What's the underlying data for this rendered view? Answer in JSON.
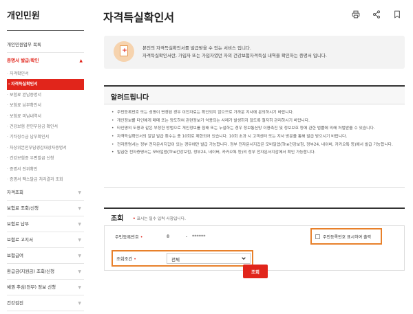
{
  "sidebar": {
    "title": "개인민원",
    "items": [
      {
        "label": "개인민원업무 목록",
        "kind": "top",
        "border": true
      },
      {
        "label": "증명서 발급/확인",
        "kind": "top",
        "active": true,
        "arrow": "▲"
      },
      {
        "label": "자격확인서",
        "kind": "sub"
      },
      {
        "label": "자격득실확인서",
        "kind": "sub",
        "current": true
      },
      {
        "label": "보험료 완납증명서",
        "kind": "sub"
      },
      {
        "label": "보험료 납부확인서",
        "kind": "sub"
      },
      {
        "label": "보험료 미납내역서",
        "kind": "sub"
      },
      {
        "label": "건강보험 본인부담금 확인서",
        "kind": "sub"
      },
      {
        "label": "기타징수금 납부확인서",
        "kind": "sub"
      },
      {
        "label": "차상위본인부담경감대상자증명서",
        "kind": "sub"
      },
      {
        "label": "건강보험증 우편발급 신청",
        "kind": "sub"
      },
      {
        "label": "증명서 진위확인",
        "kind": "sub"
      },
      {
        "label": "증명서 팩스발급 처리결과 조회",
        "kind": "sub"
      },
      {
        "label": "자격조회",
        "kind": "top",
        "border": true,
        "arrow": "▼"
      },
      {
        "label": "보험료 조회/신청",
        "kind": "top",
        "border": true,
        "arrow": "▼"
      },
      {
        "label": "보험료 납부",
        "kind": "top",
        "border": true,
        "arrow": "▼"
      },
      {
        "label": "보험료 고지서",
        "kind": "top",
        "border": true,
        "arrow": "▼"
      },
      {
        "label": "보험급여",
        "kind": "top",
        "border": true,
        "arrow": "▼"
      },
      {
        "label": "환급금(지원금) 조회/신청",
        "kind": "top",
        "border": true,
        "arrow": "▼"
      },
      {
        "label": "채권 추심(전부) 정보 신청",
        "kind": "top",
        "border": true,
        "arrow": "▼"
      },
      {
        "label": "건강검진",
        "kind": "top",
        "border": true,
        "arrow": "▼"
      }
    ]
  },
  "header": {
    "title": "자격득실확인서",
    "icons": [
      "print-icon",
      "share-icon",
      "bookmark-icon"
    ]
  },
  "intro": {
    "line1": "본인의 자격득실확인서를 발급받을 수 있는 서비스 입니다.",
    "line2": "자격득실확인서란, 가입자 또는 가입자였던 자의 건강보험자격득실 내역을 확인하는 증명서 입니다."
  },
  "notice": {
    "title": "알려드립니다",
    "items": [
      "주민등록번호 또는 성명이 변경된 경우 이전자료는 확인되지 않으므로 가까운 지사에 문의하시기 바랍니다.",
      "개인정보를 타인에게 매매 또는 양도하여 관련정보가 악용되는 사례가 발생하지 않도록 철저히 관리하시기 바랍니다.",
      "타인명의 도용과 같은 부정한 방법으로 개인정보를 침해 또는 누설하는 경우 정보통신망 이용촉진 및 정보보호 등에 관한 법률에 의해 처벌받을 수 있습니다.",
      "자격득실확인서의 일일 발급 횟수는 총 10회로 제한되어 있습니다. 10회 초과 시 고객센터 또는 지사 방문을 통해 발급 받으시기 바랍니다.",
      "전자증명서는 정부 전자문서지갑이 있는 경우에만 발급 가능합니다. 정부 전자문서지갑은 모바일앱(The건강보험, 정부24, 네이버, 카카오톡 등)에서 발급 가능합니다.",
      "발급한 전자증명서는 모바일앱(The건강보험, 정부24, 네이버, 카카오톡 등)의 정부 전자문서지갑에서 확인 가능합니다."
    ]
  },
  "search": {
    "title": "조회",
    "required_mark": "•",
    "required_note": "표시는 필수 입력 사항입니다.",
    "rrn_label": "주민등록번호",
    "rrn_front": "8",
    "rrn_dash": "-",
    "rrn_back": "******",
    "show_rrn_label": "주민등록번호 표시하여 출력",
    "cond_label": "조회조건",
    "cond_value": "전체",
    "submit_label": "조회"
  },
  "colors": {
    "accent": "#e1251b",
    "highlight": "#e8802a"
  }
}
